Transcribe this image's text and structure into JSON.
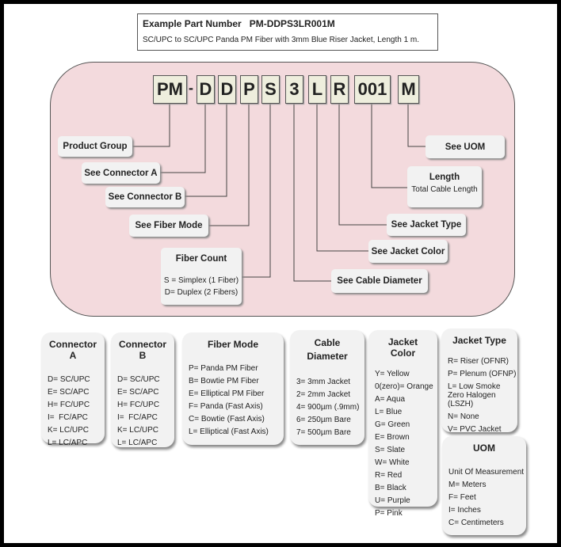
{
  "title": {
    "heading": "Example Part Number   PM-DDPS3LR001M",
    "description": "SC/UPC to SC/UPC Panda PM Fiber with 3mm Blue Riser Jacket, Length 1 m."
  },
  "colors": {
    "region": "#f3dadd",
    "code_box": "#eeeedd",
    "label_box": "#f2f2f2"
  },
  "codes": [
    "PM",
    "-",
    "D",
    "D",
    "P",
    "S",
    "3",
    "L",
    "R",
    "001",
    "M"
  ],
  "labels": {
    "product_group": "Product Group",
    "connector_a": "See Connector A",
    "connector_b": "See Connector B",
    "fiber_mode": "See Fiber Mode",
    "fiber_count": {
      "title": "Fiber Count",
      "lines": [
        "S = Simplex (1 Fiber)",
        "D= Duplex (2 Fibers)"
      ]
    },
    "cable_diameter": "See Cable Diameter",
    "jacket_color": "See Jacket Color",
    "jacket_type": "See Jacket Type",
    "length": {
      "title": "Length",
      "sub": "Total Cable Length"
    },
    "uom": "See UOM"
  },
  "legends": {
    "connector_a": {
      "title": "Connector A",
      "items": [
        "D= SC/UPC",
        "E= SC/APC",
        "H= FC/UPC",
        "I=  FC/APC",
        "K= LC/UPC",
        "L= LC/APC"
      ]
    },
    "connector_b": {
      "title": "Connector B",
      "items": [
        "D= SC/UPC",
        "E= SC/APC",
        "H= FC/UPC",
        "I=  FC/APC",
        "K= LC/UPC",
        "L= LC/APC"
      ]
    },
    "fiber_mode": {
      "title": "Fiber Mode",
      "items": [
        "P= Panda PM Fiber",
        "B= Bowtie PM Fiber",
        "E= Elliptical PM Fiber",
        "F= Panda (Fast Axis)",
        "C= Bowtie (Fast Axis)",
        "L= Elliptical (Fast Axis)"
      ]
    },
    "cable_diameter": {
      "title": "Cable Diameter",
      "items": [
        "3= 3mm Jacket",
        "2= 2mm Jacket",
        "4= 900µm (.9mm)",
        "6= 250µm Bare",
        "7= 500µm Bare"
      ]
    },
    "jacket_color": {
      "title": "Jacket Color",
      "items": [
        "Y= Yellow",
        "0(zero)= Orange",
        "A= Aqua",
        "L= Blue",
        "G= Green",
        "E= Brown",
        "S= Slate",
        "W= White",
        "R= Red",
        "B= Black",
        "U= Purple",
        "P= Pink"
      ]
    },
    "jacket_type": {
      "title": "Jacket Type",
      "items": [
        "R= Riser (OFNR)",
        "P= Plenum (OFNP)",
        "L= Low Smoke Zero Halogen (LSZH)",
        "N= None",
        "V= PVC Jacket"
      ]
    },
    "uom": {
      "title": "UOM",
      "items": [
        "Unit Of Measurement",
        "M= Meters",
        "F= Feet",
        "I= Inches",
        "C= Centimeters"
      ]
    }
  }
}
